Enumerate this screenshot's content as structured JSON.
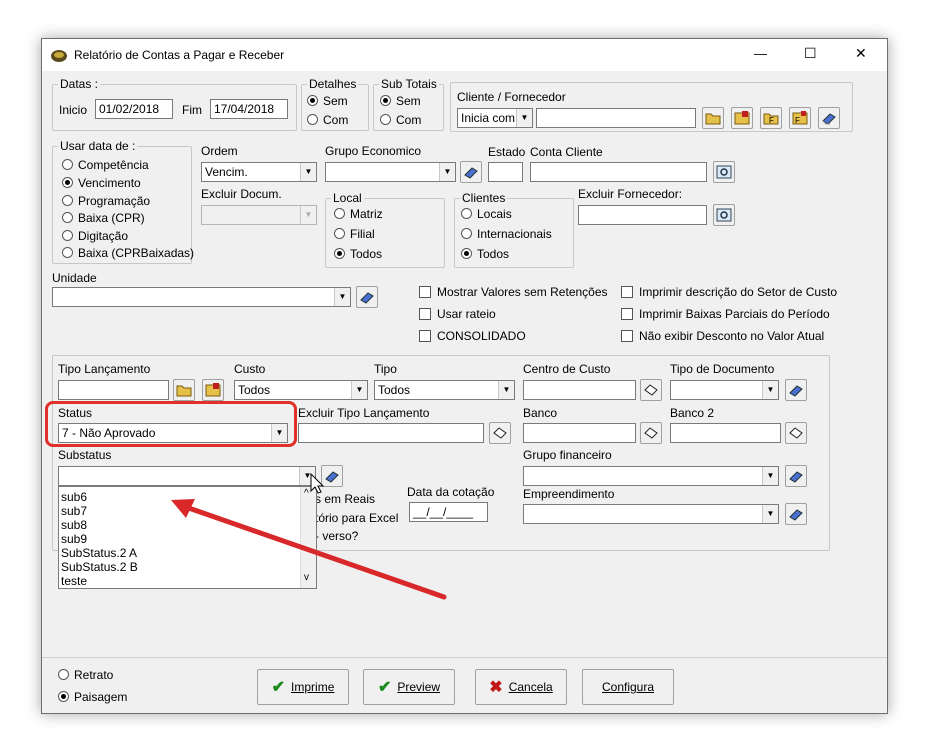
{
  "window": {
    "title": "Relatório de Contas a Pagar e Receber",
    "minimize": "—",
    "maximize": "☐",
    "close": "✕"
  },
  "datas": {
    "label": "Datas :",
    "inicio_label": "Inicio",
    "inicio_value": "01/02/2018",
    "fim_label": "Fim",
    "fim_value": "17/04/2018"
  },
  "detalhes": {
    "label": "Detalhes",
    "options": [
      "Sem",
      "Com"
    ]
  },
  "subtotais": {
    "label": "Sub Totais",
    "options": [
      "Sem",
      "Com"
    ]
  },
  "cliente": {
    "label": "Cliente / Fornecedor",
    "mode": "Inicia com"
  },
  "usar_data": {
    "label": "Usar data de :",
    "options": [
      "Competência",
      "Vencimento",
      "Programação",
      "Baixa (CPR)",
      "Digitação",
      "Baixa (CPRBaixadas)"
    ]
  },
  "ordem": {
    "label": "Ordem",
    "value": "Vencim."
  },
  "grupo_economico": {
    "label": "Grupo Economico"
  },
  "estado": {
    "label": "Estado"
  },
  "conta_cliente": {
    "label": "Conta Cliente"
  },
  "excluir_docum": {
    "label": "Excluir Docum."
  },
  "local": {
    "label": "Local",
    "options": [
      "Matriz",
      "Filial",
      "Todos"
    ]
  },
  "clientes": {
    "label": "Clientes",
    "options": [
      "Locais",
      "Internacionais",
      "Todos"
    ]
  },
  "excluir_fornecedor": {
    "label": "Excluir Fornecedor:"
  },
  "unidade": {
    "label": "Unidade"
  },
  "checks_left": [
    "Mostrar Valores sem Retenções",
    "Usar rateio",
    "CONSOLIDADO"
  ],
  "checks_right": [
    "Imprimir descrição do Setor de Custo",
    "Imprimir Baixas Parciais do Período",
    "Não exibir Desconto no Valor Atual"
  ],
  "tipo_lancamento": {
    "label": "Tipo Lançamento"
  },
  "custo": {
    "label": "Custo",
    "value": "Todos"
  },
  "tipo": {
    "label": "Tipo",
    "value": "Todos"
  },
  "centro_custo": {
    "label": "Centro de Custo"
  },
  "tipo_documento": {
    "label": "Tipo de Documento"
  },
  "status": {
    "label": "Status",
    "value": "7 - Não Aprovado"
  },
  "excluir_tipo": {
    "label": "Excluir Tipo Lançamento"
  },
  "banco": {
    "label": "Banco"
  },
  "banco2": {
    "label": "Banco 2"
  },
  "substatus": {
    "label": "Substatus",
    "options": [
      "sub6",
      "sub7",
      "sub8",
      "sub9",
      "SubStatus.2 A",
      "SubStatus.2 B",
      "teste"
    ]
  },
  "grupo_financeiro": {
    "label": "Grupo financeiro"
  },
  "hidden_text": {
    "reais": "s em Reais",
    "excel": "tório para Excel",
    "verso": "- verso?"
  },
  "data_cotacao": {
    "label": "Data da cotação",
    "value": "__/__/____"
  },
  "empreendimento": {
    "label": "Empreendimento"
  },
  "orientacao": {
    "options": [
      "Retrato",
      "Paisagem"
    ]
  },
  "buttons": {
    "imprime": "Imprime",
    "preview": "Preview",
    "cancela": "Cancela",
    "configura": "Configura"
  },
  "colors": {
    "highlight": "#e0302a",
    "check_green": "#1a8a1a",
    "cancel_red": "#c01818"
  }
}
